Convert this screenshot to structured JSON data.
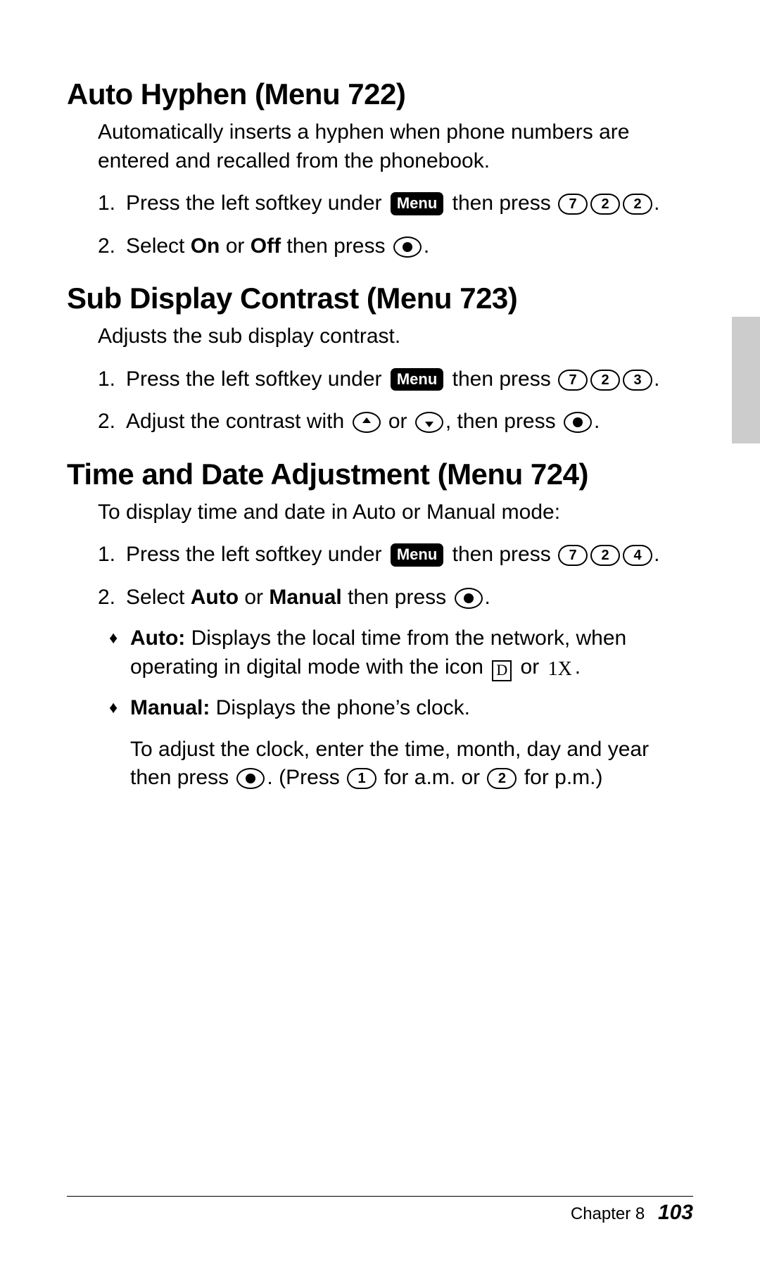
{
  "sections": [
    {
      "heading": "Auto Hyphen (Menu 722)",
      "intro": "Automatically inserts a hyphen when phone numbers are entered and recalled from the phonebook.",
      "steps": [
        {
          "n": "1.",
          "pre": "Press the left softkey under ",
          "menu": "Menu",
          "mid": " then press ",
          "keys": [
            "7",
            "2",
            "2"
          ],
          "post": "."
        },
        {
          "n": "2.",
          "pre": "Select ",
          "bold1": "On",
          "mid1": " or ",
          "bold2": "Off",
          "mid2": " then press ",
          "ok": true,
          "post": "."
        }
      ]
    },
    {
      "heading": "Sub Display Contrast (Menu 723)",
      "intro": "Adjusts the sub display contrast.",
      "steps": [
        {
          "n": "1.",
          "pre": "Press the left softkey under ",
          "menu": "Menu",
          "mid": " then press ",
          "keys": [
            "7",
            "2",
            "3"
          ],
          "post": "."
        },
        {
          "n": "2.",
          "pre": "Adjust the contrast with ",
          "arrowUp": true,
          "mid1": " or ",
          "arrowDown": true,
          "mid2": ", then press ",
          "ok": true,
          "post": "."
        }
      ]
    },
    {
      "heading": "Time and Date Adjustment (Menu 724)",
      "intro": "To display time and date in Auto or Manual mode:",
      "steps": [
        {
          "n": "1.",
          "pre": "Press the left softkey under ",
          "menu": "Menu",
          "mid": " then press ",
          "keys": [
            "7",
            "2",
            "4"
          ],
          "post": "."
        },
        {
          "n": "2.",
          "pre": "Select ",
          "bold1": "Auto",
          "mid1": " or ",
          "bold2": "Manual",
          "mid2": " then press ",
          "ok": true,
          "post": "."
        }
      ],
      "bullets": [
        {
          "label": "Auto:",
          "text1": " Displays the local time from the network, when operating in digital mode with the icon ",
          "iconD": "D",
          "text2": " or ",
          "iconX": "1X",
          "text3": "."
        },
        {
          "label": "Manual:",
          "text1": " Displays the phone’s clock."
        }
      ],
      "tail": {
        "t1": "To adjust the clock, enter the time, month, day and year then press ",
        "ok": true,
        "t2": ". (Press ",
        "k1": "1",
        "t3": " for a.m. or ",
        "k2": "2",
        "t4": " for p.m.)"
      }
    }
  ],
  "footer": {
    "chapter": "Chapter 8",
    "page": "103"
  }
}
